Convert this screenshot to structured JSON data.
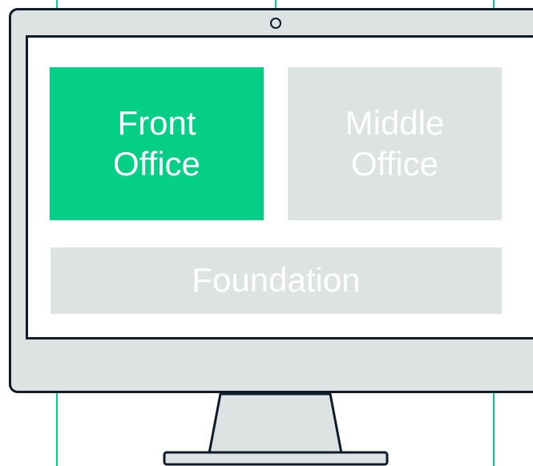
{
  "blocks": {
    "front_office": "Front\nOffice",
    "middle_office": "Middle\nOffice",
    "foundation": "Foundation"
  },
  "colors": {
    "accent_green": "#05cf86",
    "panel_gray": "#dde3e3",
    "outline_dark": "#0f1b2b",
    "screen_white": "#ffffff"
  },
  "icons": [
    "monitor-icon",
    "camera-icon",
    "monitor-stand-icon"
  ]
}
